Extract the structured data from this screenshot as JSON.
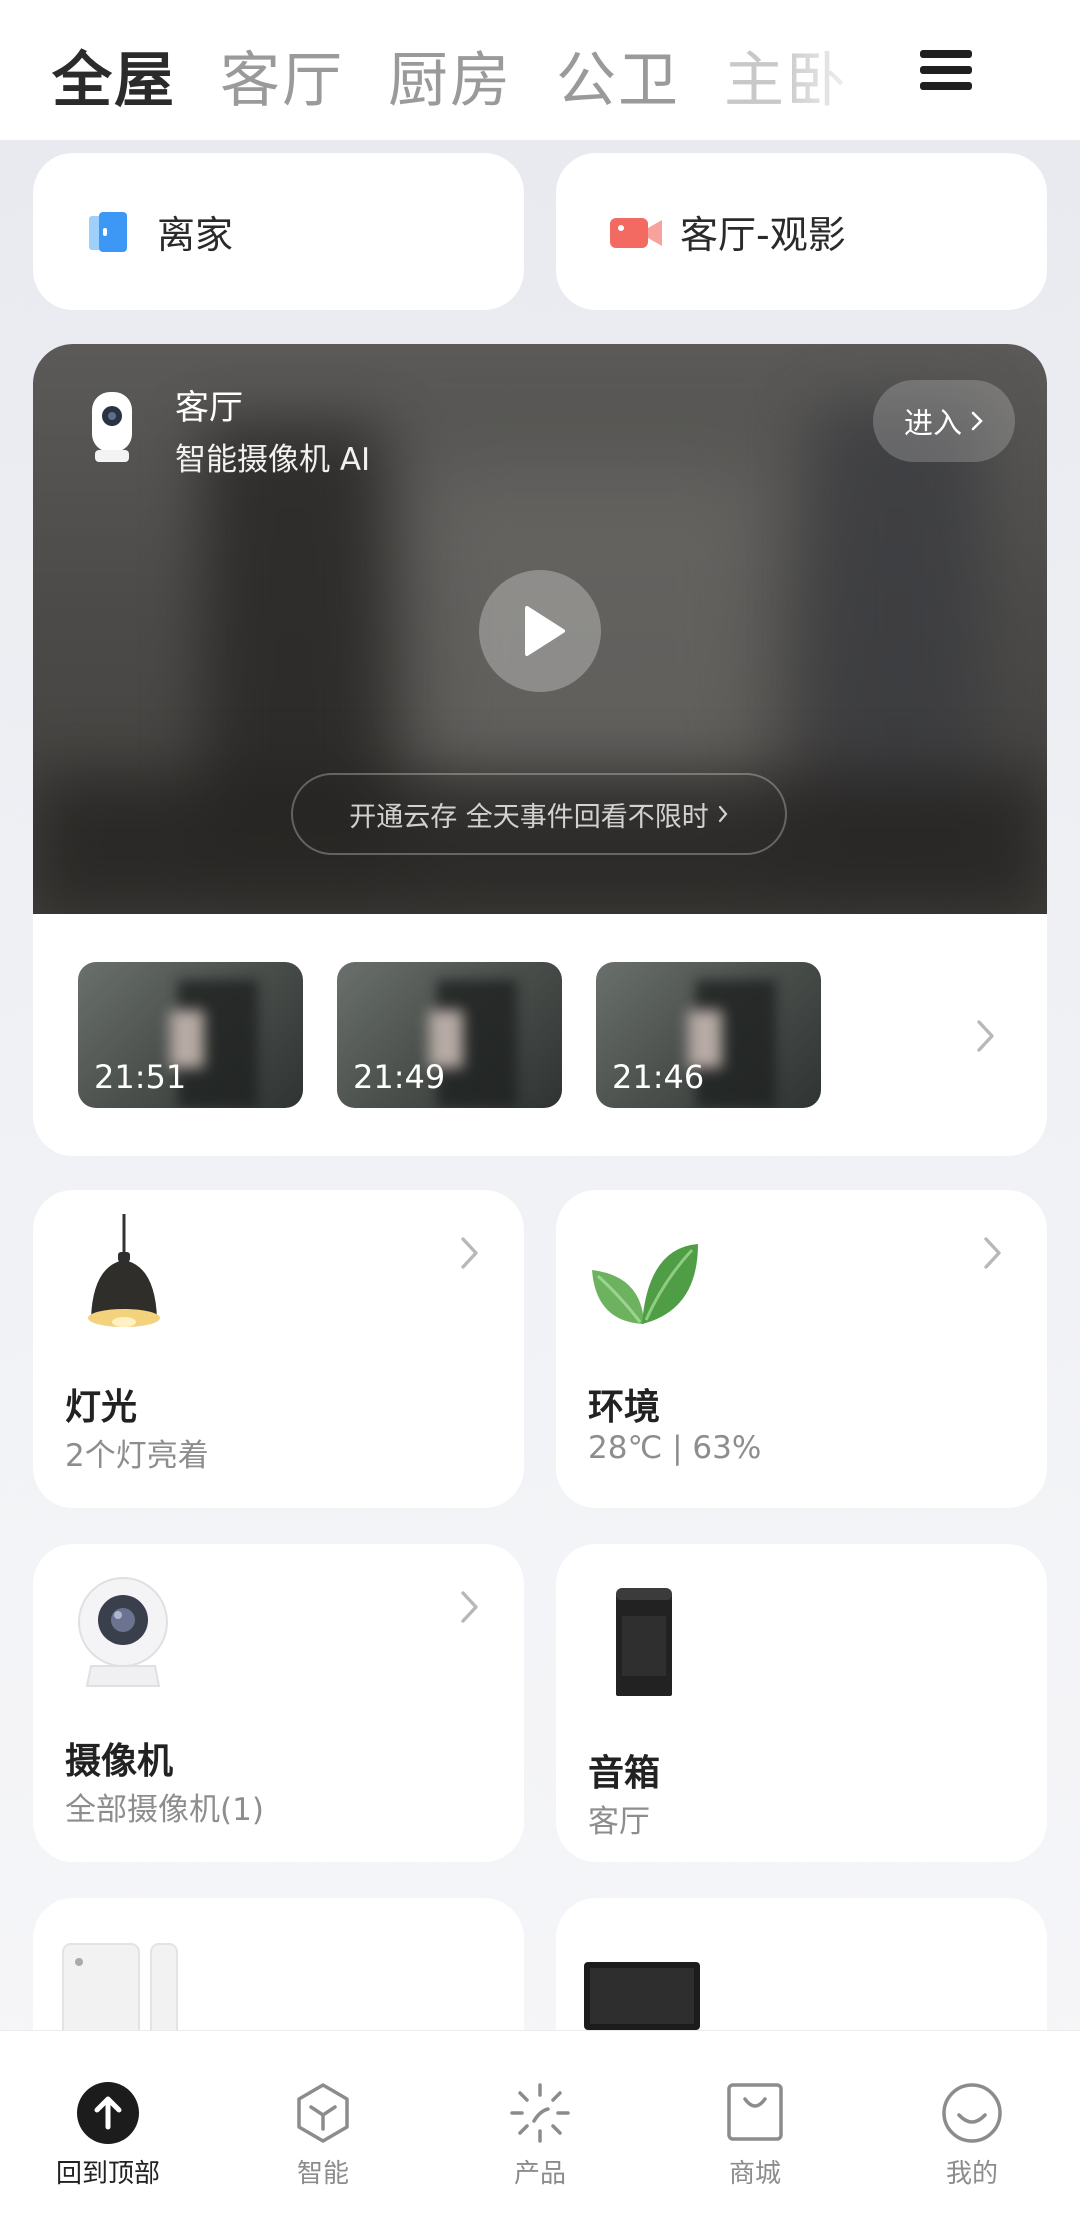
{
  "tabs": [
    "全屋",
    "客厅",
    "厨房",
    "公卫",
    "主卧"
  ],
  "scenes": [
    {
      "label": "离家",
      "icon": "door-icon",
      "color": "#4fa3f7"
    },
    {
      "label": "客厅-观影",
      "icon": "video-camera-icon",
      "color": "#f26a62"
    }
  ],
  "camera": {
    "room": "客厅",
    "model": "智能摄像机 AI",
    "enter_label": "进入",
    "cloud_label": "开通云存 全天事件回看不限时",
    "clips": [
      "21:51",
      "21:49",
      "21:46"
    ]
  },
  "devices": [
    {
      "title": "灯光",
      "subtitle": "2个灯亮着",
      "icon": "pendant-lamp-icon"
    },
    {
      "title": "环境",
      "subtitle": "28℃ | 63%",
      "icon": "leaf-icon"
    },
    {
      "title": "摄像机",
      "subtitle": "全部摄像机(1)",
      "icon": "dome-camera-icon"
    },
    {
      "title": "音箱",
      "subtitle": "客厅",
      "icon": "smart-speaker-icon"
    }
  ],
  "nav": [
    "回到顶部",
    "智能",
    "产品",
    "商城",
    "我的"
  ]
}
